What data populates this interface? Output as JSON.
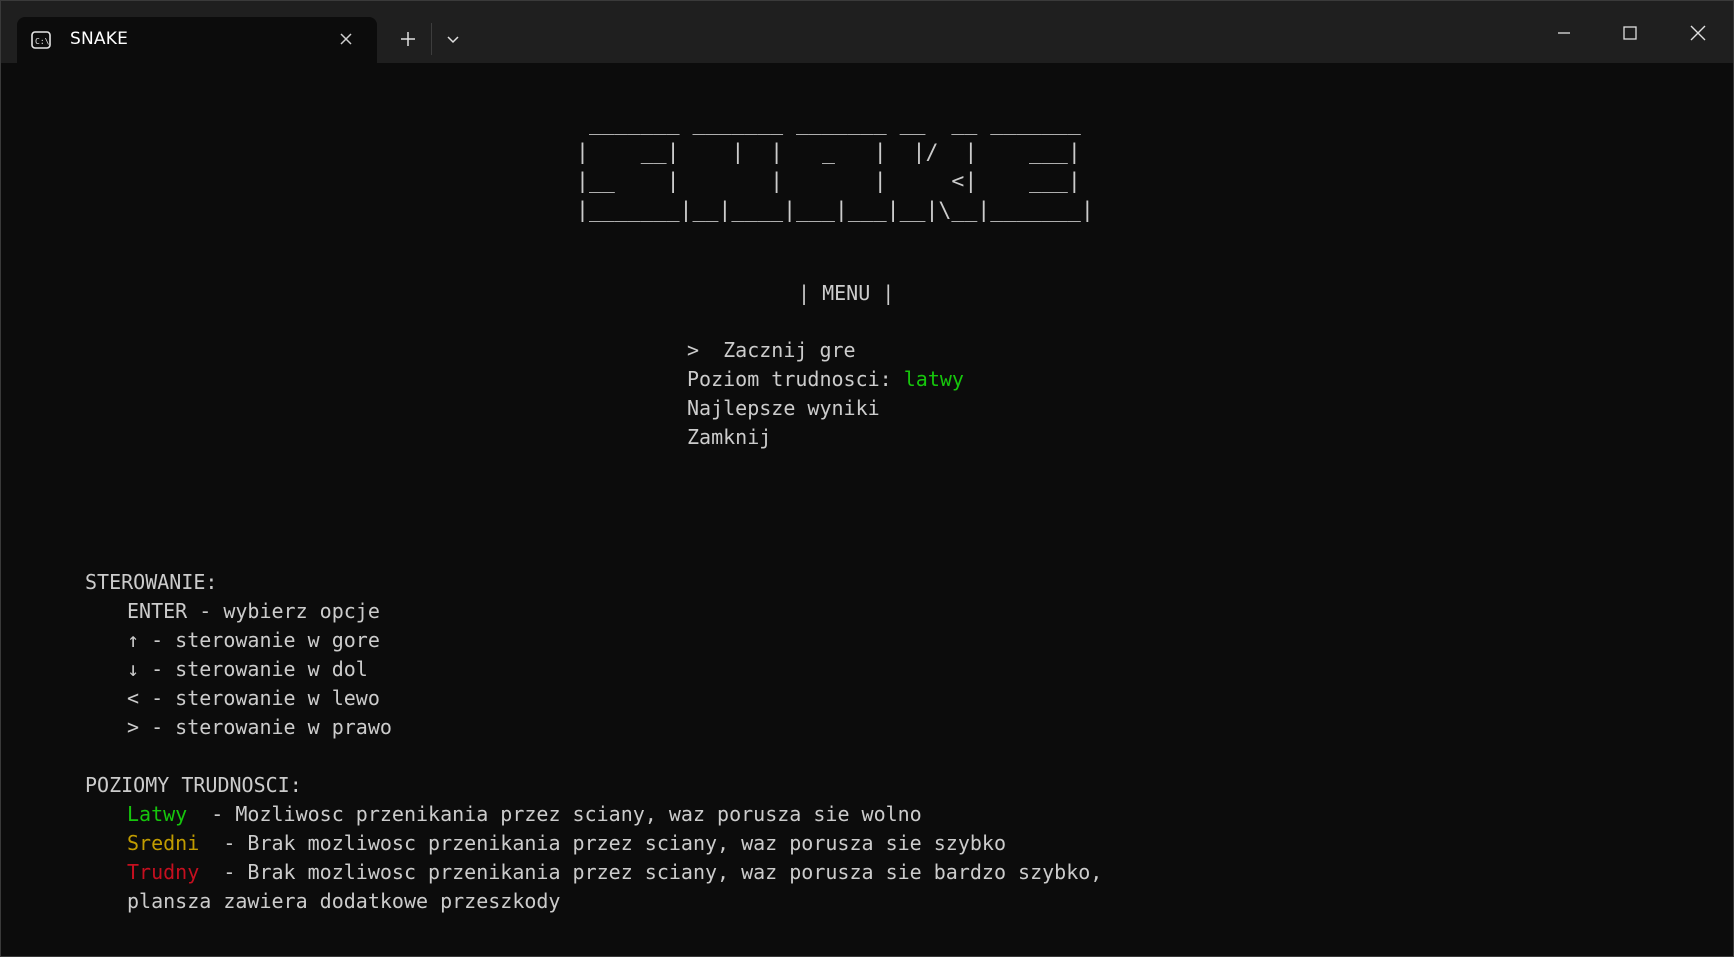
{
  "window": {
    "tab_title": "SNAKE",
    "tab_icon": "terminal-icon",
    "controls": [
      "minimize-icon",
      "maximize-icon",
      "close-icon"
    ]
  },
  "terminal": {
    "logo_lines": [
      " _______ _______ _______ __  __ _______",
      "|    __|    |  |   _   |  |/  |    ___|",
      "|__    |       |       |     <|    ___|",
      "|_______|__|____|___|___|__|\\__|_______|"
    ],
    "menu_title": "| MENU |",
    "menu": {
      "cursor": ">",
      "start": "Zacznij gre",
      "difficulty_label": "Poziom trudnosci:",
      "difficulty_value": "latwy",
      "highscores": "Najlepsze wyniki",
      "exit": "Zamknij"
    },
    "controls_title": "STEROWANIE:",
    "controls": [
      "ENTER - wybierz opcje",
      "↑ - sterowanie w gore",
      "↓ - sterowanie w dol",
      "< - sterowanie w lewo",
      "> - sterowanie w prawo"
    ],
    "levels_title": "POZIOMY TRUDNOSCI:",
    "levels": [
      {
        "name": "Latwy",
        "desc": " - Mozliwosc przenikania przez sciany, waz porusza sie wolno",
        "color": "#16c60c"
      },
      {
        "name": "Sredni",
        "desc": " - Brak mozliwosc przenikania przez sciany, waz porusza sie szybko",
        "color": "#c19c00"
      },
      {
        "name": "Trudny",
        "desc": " - Brak mozliwosc przenikania przez sciany, waz porusza sie bardzo szybko,",
        "color": "#c50f1f"
      }
    ],
    "levels_continuation": "plansza zawiera dodatkowe przeszkody"
  },
  "colors": {
    "background": "#0c0c0c",
    "text": "#cccccc",
    "titlebar": "#1f1f1f"
  }
}
